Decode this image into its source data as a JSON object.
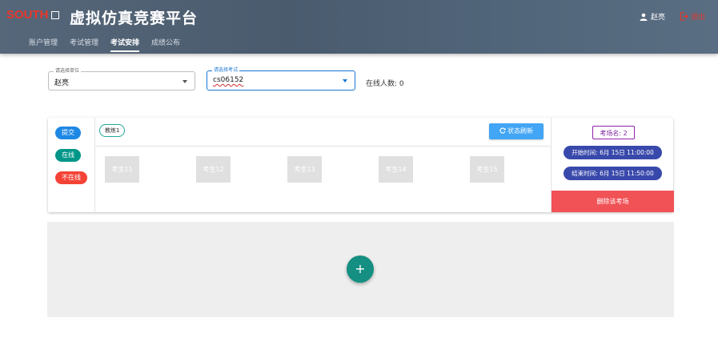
{
  "header": {
    "brand_text": "SOUTH",
    "brand_mark_text": "南方测绘",
    "app_title": "虚拟仿真竞赛平台",
    "nav": [
      {
        "label": "账户管理",
        "active": false
      },
      {
        "label": "考试管理",
        "active": false
      },
      {
        "label": "考试安排",
        "active": true
      },
      {
        "label": "成绩公布",
        "active": false
      }
    ],
    "user_name": "赵亮",
    "logout_label": "退出"
  },
  "filters": {
    "unit": {
      "legend": "请选择单位",
      "value": "赵亮"
    },
    "exam": {
      "legend": "请选择考试",
      "value": "cs06152"
    },
    "online_label": "在线人数: 0"
  },
  "legend_pills": [
    {
      "label": "提交",
      "color": "#1e88e5"
    },
    {
      "label": "在线",
      "color": "#009688"
    },
    {
      "label": "不在线",
      "color": "#f44336"
    }
  ],
  "exam_card": {
    "coach_tag": "教练1",
    "refresh_label": "状态刷新",
    "students": [
      "考生11",
      "考生12",
      "考生13",
      "考生14",
      "考生15"
    ],
    "room_name": "考场名: 2",
    "start_time": "开始时间: 6月 15日 11:00:00",
    "end_time": "结束时间: 6月 15日 11:50:00",
    "delete_label": "删除该考场"
  },
  "add_button_label": "+",
  "colors": {
    "header_bg": "#4f6175",
    "accent_blue": "#1976d2",
    "refresh_blue": "#42a5f5",
    "time_pill": "#3949ab",
    "delete_red": "#f05256",
    "add_teal": "#148f82",
    "brand_red": "#e8382c"
  }
}
